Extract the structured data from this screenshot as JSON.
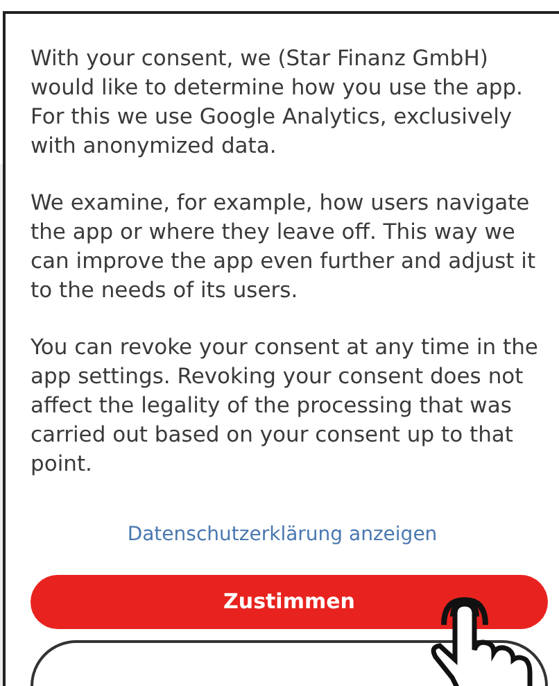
{
  "paragraphs": [
    "With your consent, we (Star Finanz GmbH) would like to determine how you use the app. For this we use Google Analytics, exclusively with anonymized data.",
    "We examine, for example, how users navigate the app or where they leave off. This way we can improve the app even further and adjust it to the needs of its users.",
    "You can revoke your consent at any time in the app settings. Revoking your consent does not affect the legality of the processing that was carried out based on your consent up to that point."
  ],
  "privacy_link": "Datenschutzerklärung anzeigen",
  "accept_button": "Zustimmen"
}
